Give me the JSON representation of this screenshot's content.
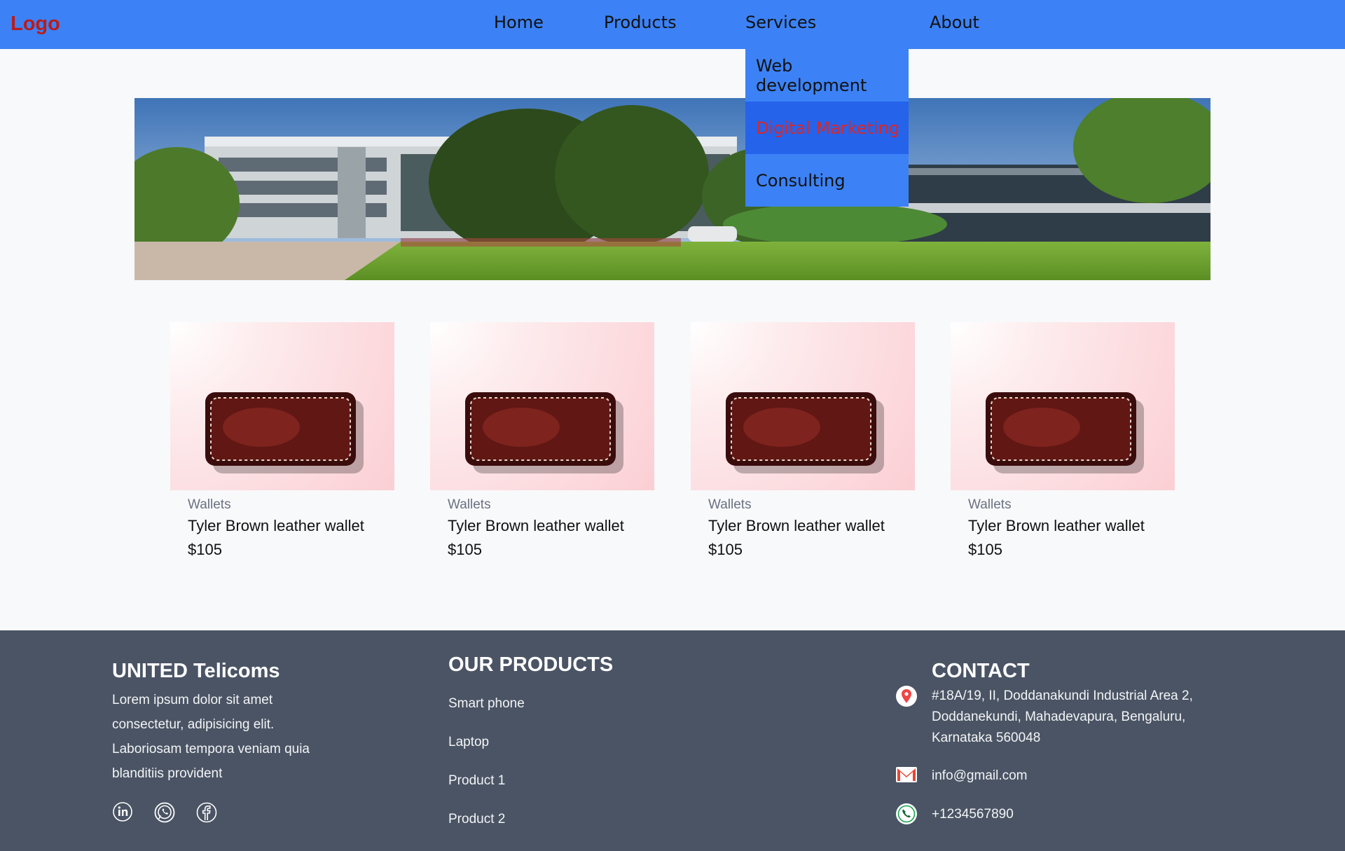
{
  "nav": {
    "logo": "Logo",
    "links": [
      "Home",
      "Products",
      "Services",
      "About"
    ],
    "dropdown": [
      "Web development",
      "Digital Marketing",
      "Consulting"
    ]
  },
  "products": [
    {
      "category": "Wallets",
      "title": "Tyler Brown leather wallet",
      "price": "$105"
    },
    {
      "category": "Wallets",
      "title": "Tyler Brown leather wallet",
      "price": "$105"
    },
    {
      "category": "Wallets",
      "title": "Tyler Brown leather wallet",
      "price": "$105"
    },
    {
      "category": "Wallets",
      "title": "Tyler Brown leather wallet",
      "price": "$105"
    }
  ],
  "footer": {
    "company": {
      "name": "UNITED Telicoms",
      "description": "Lorem ipsum dolor sit amet consectetur, adipisicing elit. Laboriosam tempora veniam quia blanditiis provident",
      "social_icons": [
        "linkedin-icon",
        "whatsapp-icon",
        "facebook-icon"
      ]
    },
    "products": {
      "heading": "OUR PRODUCTS",
      "items": [
        "Smart phone",
        "Laptop",
        "Product 1",
        "Product 2"
      ]
    },
    "contact": {
      "heading": "CONTACT",
      "address": "#18A/19, II, Doddanakundi Industrial Area 2, Doddanekundi, Mahadevapura, Bengaluru, Karnataka 560048",
      "email": "info@gmail.com",
      "phone": "+1234567890"
    }
  },
  "colors": {
    "nav_bg": "#3c82f6",
    "logo": "#b91c1c",
    "dropdown_active_text": "#dc2626",
    "footer_bg": "#4a5464"
  }
}
